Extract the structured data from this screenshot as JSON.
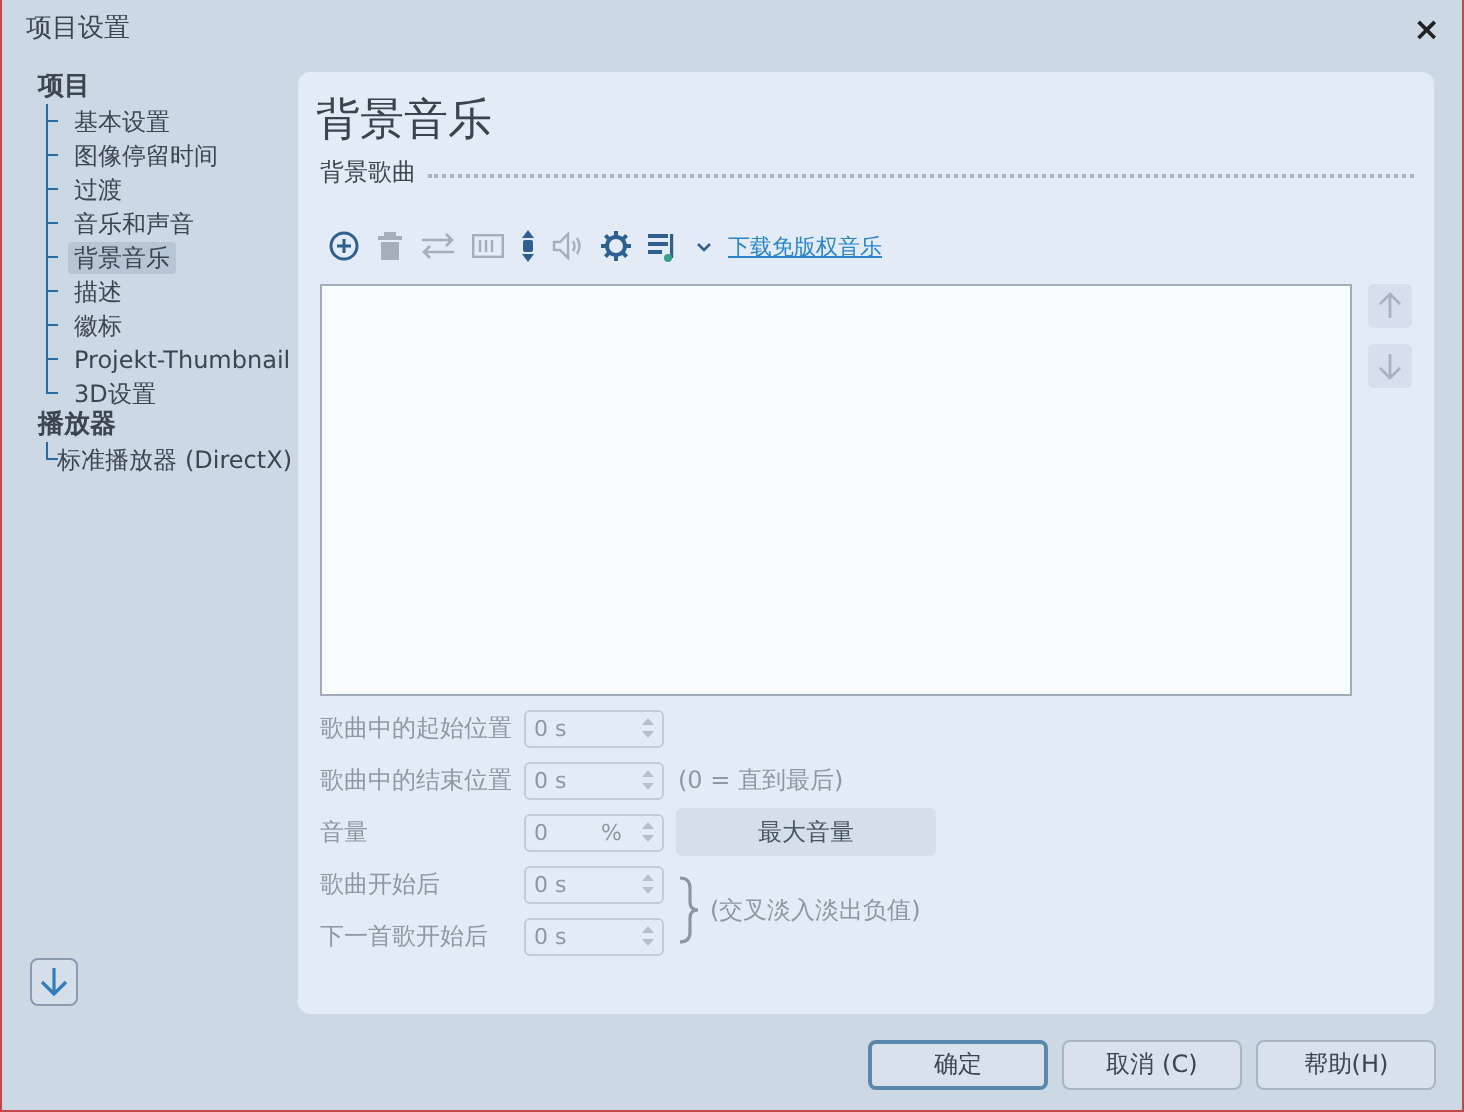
{
  "window": {
    "title": "项目设置",
    "close": "×"
  },
  "sidebar": {
    "items": [
      {
        "label": "项目",
        "selected": false,
        "children": [
          {
            "label": "基本设置",
            "selected": false
          },
          {
            "label": "图像停留时间",
            "selected": false
          },
          {
            "label": "过渡",
            "selected": false
          },
          {
            "label": "音乐和声音",
            "selected": false
          },
          {
            "label": "背景音乐",
            "selected": true
          },
          {
            "label": "描述",
            "selected": false
          },
          {
            "label": "徽标",
            "selected": false
          },
          {
            "label": "Projekt-Thumbnail",
            "selected": false
          },
          {
            "label": "3D设置",
            "selected": false
          }
        ]
      },
      {
        "label": "播放器",
        "selected": false,
        "children": [
          {
            "label": "标准播放器 (DirectX)",
            "selected": false
          }
        ]
      }
    ]
  },
  "panel": {
    "title": "背景音乐",
    "section": "背景歌曲",
    "toolbar": [
      {
        "kind": "add",
        "disabled": false
      },
      {
        "kind": "delete",
        "disabled": true
      },
      {
        "kind": "swap",
        "disabled": true
      },
      {
        "kind": "film",
        "disabled": true
      },
      {
        "kind": "updown",
        "disabled": false
      },
      {
        "kind": "volume",
        "disabled": true
      },
      {
        "kind": "gear",
        "disabled": false
      },
      {
        "kind": "music",
        "disabled": false
      },
      {
        "kind": "caret",
        "disabled": false
      }
    ],
    "link": "下载免版权音乐",
    "fields": [
      {
        "label": "歌曲中的起始位置",
        "value": "0 s"
      },
      {
        "label": "歌曲中的结束位置",
        "value": "0 s",
        "note": "(0 = 直到最后)"
      }
    ],
    "volume": {
      "label": "音量",
      "value": "0",
      "unit": "%",
      "button": "最大音量"
    },
    "fades": [
      {
        "label": "歌曲开始后",
        "value": "0 s"
      },
      {
        "label": "下一首歌开始后",
        "value": "0 s"
      }
    ],
    "fade_note": "(交叉淡入淡出负值)"
  },
  "buttons": [
    {
      "label": "确定",
      "default": true
    },
    {
      "label": "取消 (C)",
      "default": false
    },
    {
      "label": "帮助(H)",
      "default": false
    }
  ]
}
